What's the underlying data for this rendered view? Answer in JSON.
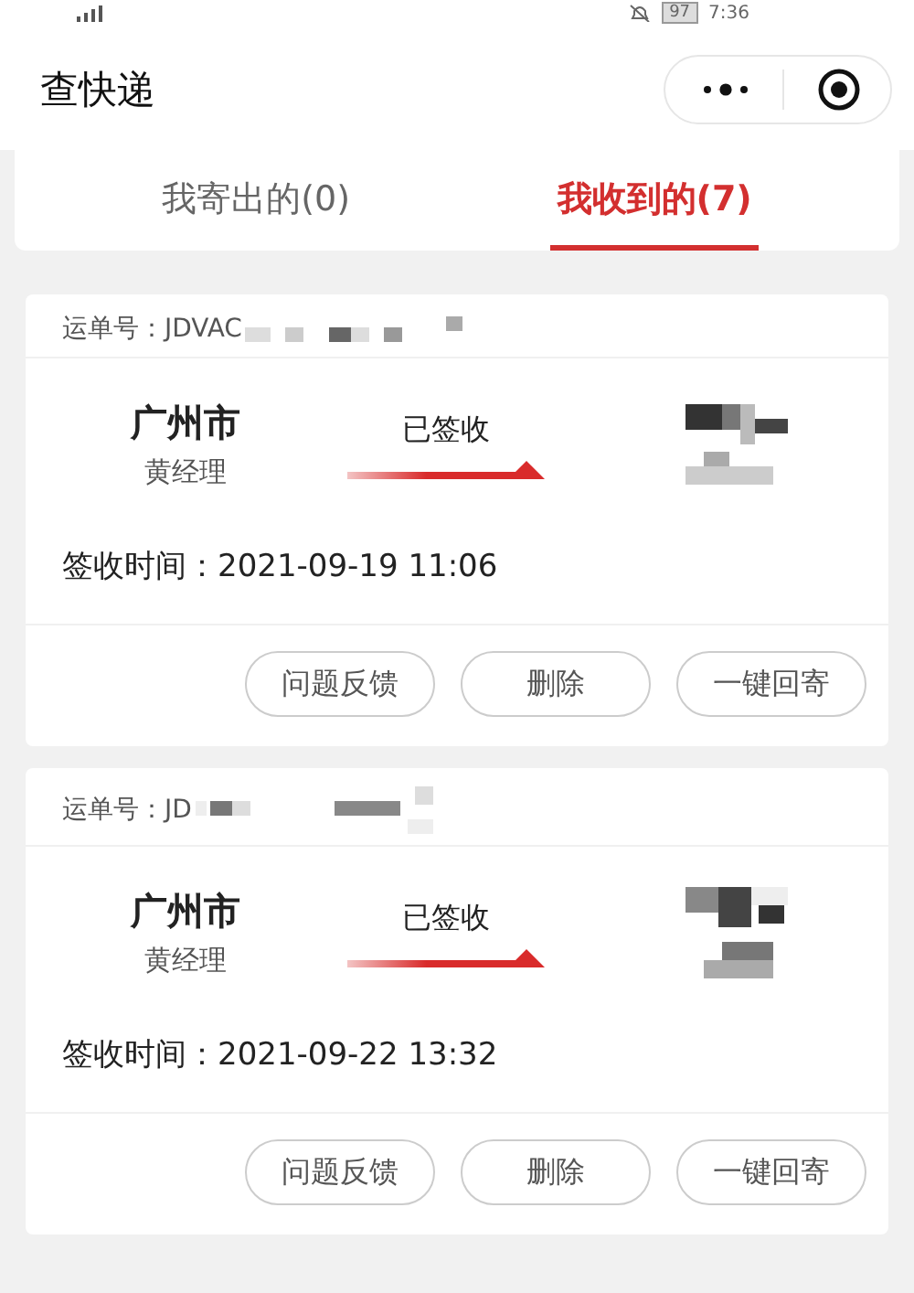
{
  "status_bar": {
    "battery": "97",
    "time": "7:36"
  },
  "header": {
    "title": "查快递"
  },
  "tabs": [
    {
      "label": "我寄出的(0)",
      "selected": false
    },
    {
      "label": "我收到的(7)",
      "selected": true
    }
  ],
  "shipments": [
    {
      "waybill_label": "运单号：",
      "waybill": "JDVAC",
      "from_city": "广州市",
      "from_contact": "黄经理",
      "status": "已签收",
      "time_label": "签收时间：",
      "time": "2021-09-19 11:06",
      "actions": [
        "问题反馈",
        "删除",
        "一键回寄"
      ]
    },
    {
      "waybill_label": "运单号：",
      "waybill": "JD",
      "from_city": "广州市",
      "from_contact": "黄经理",
      "status": "已签收",
      "time_label": "签收时间：",
      "time": "2021-09-22 13:32",
      "actions": [
        "问题反馈",
        "删除",
        "一键回寄"
      ]
    }
  ]
}
